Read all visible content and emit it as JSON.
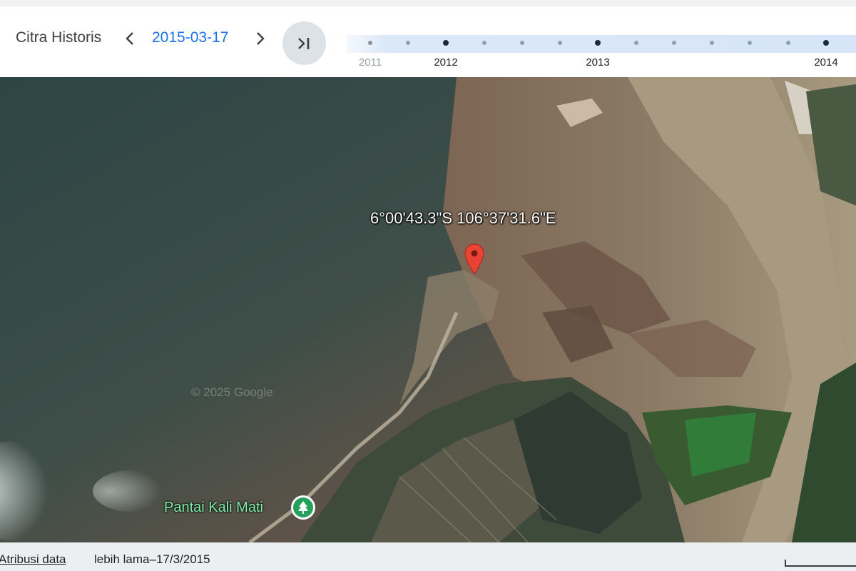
{
  "toolbar": {
    "title": "Citra Historis",
    "date": "2015-03-17",
    "prev_icon": "chevron-left-icon",
    "next_icon": "chevron-right-icon",
    "latest_icon": "skip-to-latest-icon"
  },
  "timeline": {
    "years": [
      {
        "label": "2011",
        "faded": true
      },
      {
        "label": "2012",
        "faded": false
      },
      {
        "label": "2013",
        "faded": false
      },
      {
        "label": "2014",
        "faded": false
      }
    ],
    "accent_color": "#1a73e8"
  },
  "map": {
    "coordinates": "6°00'43.3\"S 106°37'31.6\"E",
    "watermark": "© 2025 Google",
    "poi": {
      "label": "Pantai Kali Mati",
      "icon": "tree-icon",
      "color": "#24a15a"
    },
    "pin_icon": "map-pin-icon",
    "pin_color": "#ea4335"
  },
  "footer": {
    "attribution_link": "Atribusi data",
    "older_date": "lebih lama–17/3/2015"
  }
}
